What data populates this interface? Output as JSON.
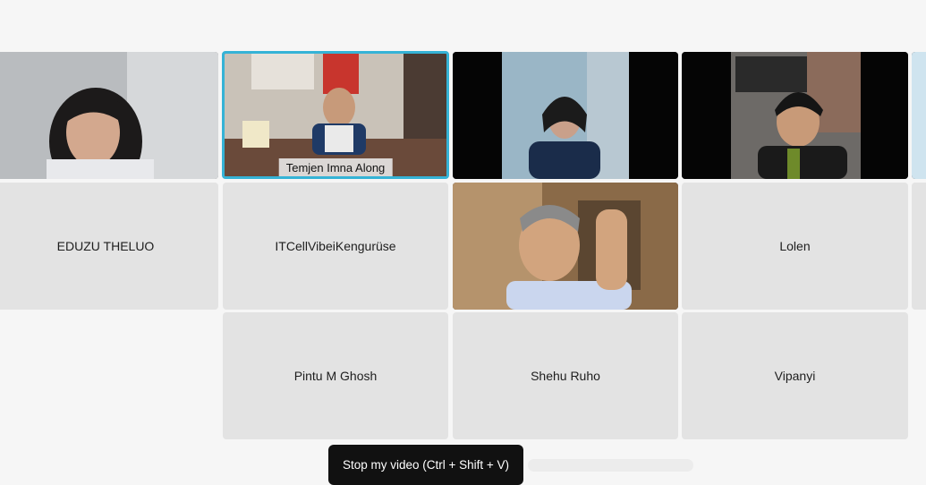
{
  "participants": {
    "video_tiles": [
      {
        "id": "p1",
        "name": "",
        "camera": "on"
      },
      {
        "id": "p2",
        "name": "Temjen Imna Along",
        "camera": "on",
        "active_speaker": true
      },
      {
        "id": "p3",
        "name": "",
        "camera": "on"
      },
      {
        "id": "p4",
        "name": "",
        "camera": "on"
      },
      {
        "id": "p5",
        "name": "",
        "camera": "on"
      }
    ],
    "name_tiles": {
      "eduzu": "EDUZU THELUO",
      "itcell": "ITCellVibeiKengurüse",
      "lolen": "Lolen",
      "pintu": "Pintu M Ghosh",
      "shehu": "Shehu Ruho",
      "vipanyi": "Vipanyi"
    }
  },
  "tooltip": {
    "text": "Stop my video (Ctrl + Shift + V)"
  },
  "colors": {
    "background": "#f6f6f6",
    "tile_background": "#e3e3e3",
    "active_speaker_border": "#35b3d6",
    "tooltip_background": "#111111"
  }
}
